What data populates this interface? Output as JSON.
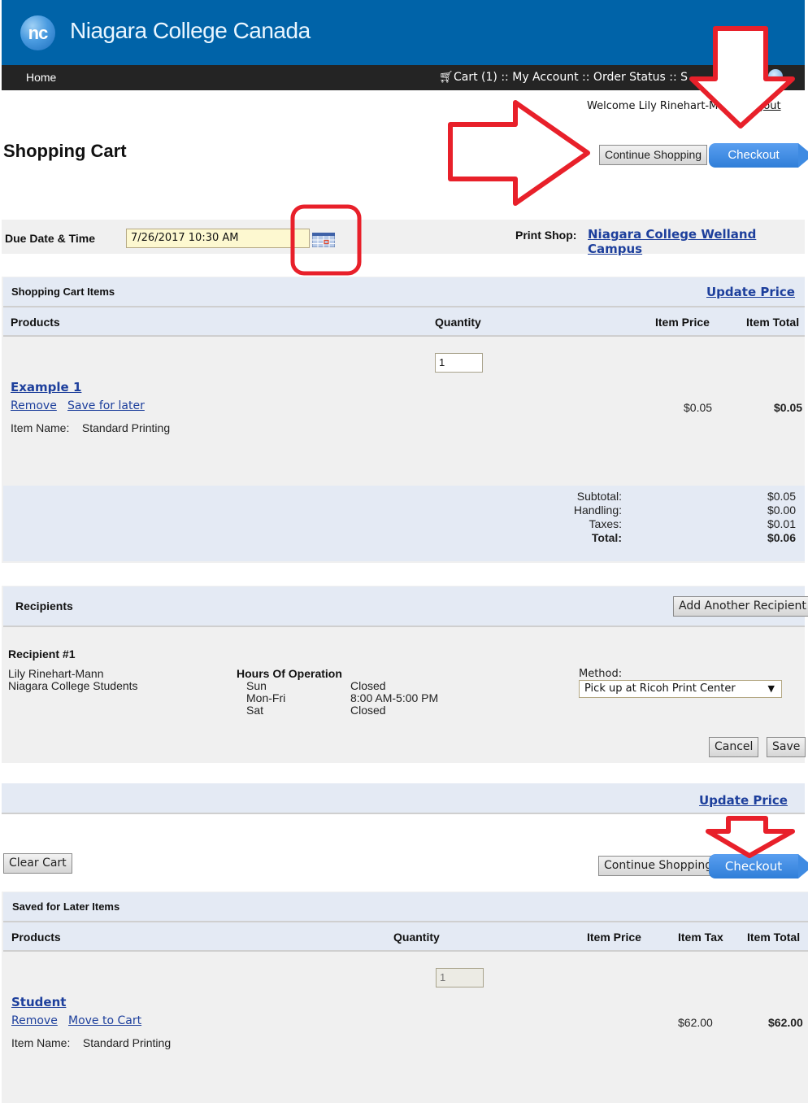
{
  "header": {
    "logo_mark": "nc",
    "site_name": "Niagara College Canada",
    "nav_home": "Home",
    "nav_cart": "Cart (1)",
    "nav_sep": " :: ",
    "nav_account": "My Account",
    "nav_order_status": "Order Status",
    "nav_trailing": " :: S",
    "welcome_text": "Welcome Lily Rinehart-Mann",
    "logout": "Logout"
  },
  "page": {
    "title": "Shopping Cart",
    "continue_shopping": "Continue Shopping",
    "checkout": "Checkout"
  },
  "due": {
    "label": "Due Date & Time",
    "value": "7/26/2017 10:30 AM",
    "print_shop_label": "Print Shop:",
    "print_shop_link": "Niagara College Welland Campus"
  },
  "cart": {
    "section_title": "Shopping Cart Items",
    "update_price": "Update Price",
    "columns": [
      "Products",
      "Quantity",
      "Item Price",
      "Item Total"
    ],
    "items": [
      {
        "product": "Example 1",
        "quantity": "1",
        "remove": "Remove",
        "save_for_later": "Save for later",
        "item_name_label": "Item Name:",
        "item_name_value": "Standard Printing",
        "item_price": "$0.05",
        "item_total": "$0.05"
      }
    ],
    "totals": [
      {
        "label": "Subtotal:",
        "value": "$0.05"
      },
      {
        "label": "Handling:",
        "value": "$0.00"
      },
      {
        "label": "Taxes:",
        "value": "$0.01"
      },
      {
        "label": "Total:",
        "value": "$0.06"
      }
    ]
  },
  "recipients": {
    "section_title": "Recipients",
    "add_button": "Add Another Recipient",
    "recipient_heading": "Recipient #1",
    "name": "Lily Rinehart-Mann",
    "organization": "Niagara College Students",
    "hours_title": "Hours Of Operation",
    "hours": [
      {
        "day": "Sun",
        "time": "Closed"
      },
      {
        "day": "Mon-Fri",
        "time": "8:00 AM-5:00 PM"
      },
      {
        "day": "Sat",
        "time": "Closed"
      }
    ],
    "method_label": "Method:",
    "method_value": "Pick up at Ricoh Print Center",
    "cancel": "Cancel",
    "save": "Save"
  },
  "bottom": {
    "update_price": "Update Price",
    "clear_cart": "Clear Cart",
    "continue_shopping": "Continue Shopping",
    "checkout": "Checkout"
  },
  "saved": {
    "section_title": "Saved for Later Items",
    "columns": [
      "Products",
      "Quantity",
      "Item Price",
      "Item Tax",
      "Item Total"
    ],
    "items": [
      {
        "product": "Student",
        "quantity": "1",
        "remove": "Remove",
        "move_to_cart": "Move to Cart",
        "item_name_label": "Item Name:",
        "item_name_value": "Standard Printing",
        "item_price": "$62.00",
        "item_total": "$62.00"
      }
    ]
  },
  "annotation_color": "#e8202a"
}
